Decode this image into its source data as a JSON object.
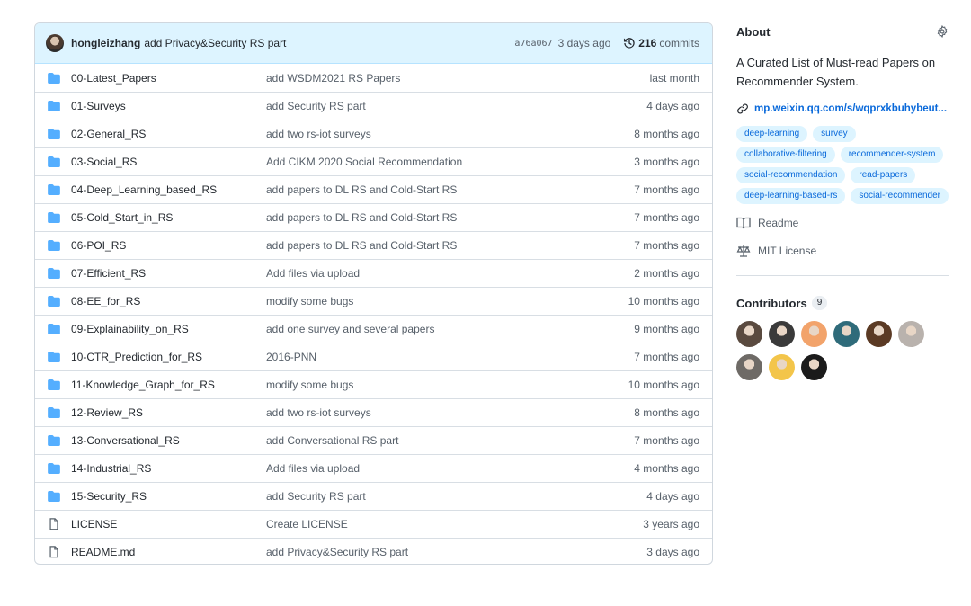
{
  "commit": {
    "author": "hongleizhang",
    "message": "add Privacy&Security RS part",
    "sha": "a76a067",
    "ago": "3 days ago",
    "count": "216",
    "count_label": "commits"
  },
  "files": [
    {
      "type": "dir",
      "name": "00-Latest_Papers",
      "message": "add WSDM2021 RS Papers",
      "age": "last month"
    },
    {
      "type": "dir",
      "name": "01-Surveys",
      "message": "add Security RS part",
      "age": "4 days ago"
    },
    {
      "type": "dir",
      "name": "02-General_RS",
      "message": "add two rs-iot surveys",
      "age": "8 months ago"
    },
    {
      "type": "dir",
      "name": "03-Social_RS",
      "message": "Add CIKM 2020 Social Recommendation",
      "age": "3 months ago"
    },
    {
      "type": "dir",
      "name": "04-Deep_Learning_based_RS",
      "message": "add papers to DL RS and Cold-Start RS",
      "age": "7 months ago"
    },
    {
      "type": "dir",
      "name": "05-Cold_Start_in_RS",
      "message": "add papers to DL RS and Cold-Start RS",
      "age": "7 months ago"
    },
    {
      "type": "dir",
      "name": "06-POI_RS",
      "message": "add papers to DL RS and Cold-Start RS",
      "age": "7 months ago"
    },
    {
      "type": "dir",
      "name": "07-Efficient_RS",
      "message": "Add files via upload",
      "age": "2 months ago"
    },
    {
      "type": "dir",
      "name": "08-EE_for_RS",
      "message": "modify some bugs",
      "age": "10 months ago"
    },
    {
      "type": "dir",
      "name": "09-Explainability_on_RS",
      "message": "add one survey and several papers",
      "age": "9 months ago"
    },
    {
      "type": "dir",
      "name": "10-CTR_Prediction_for_RS",
      "message": "2016-PNN",
      "age": "7 months ago"
    },
    {
      "type": "dir",
      "name": "11-Knowledge_Graph_for_RS",
      "message": "modify some bugs",
      "age": "10 months ago"
    },
    {
      "type": "dir",
      "name": "12-Review_RS",
      "message": "add two rs-iot surveys",
      "age": "8 months ago"
    },
    {
      "type": "dir",
      "name": "13-Conversational_RS",
      "message": "add Conversational RS part",
      "age": "7 months ago"
    },
    {
      "type": "dir",
      "name": "14-Industrial_RS",
      "message": "Add files via upload",
      "age": "4 months ago"
    },
    {
      "type": "dir",
      "name": "15-Security_RS",
      "message": "add Security RS part",
      "age": "4 days ago"
    },
    {
      "type": "file",
      "name": "LICENSE",
      "message": "Create LICENSE",
      "age": "3 years ago"
    },
    {
      "type": "file",
      "name": "README.md",
      "message": "add Privacy&Security RS part",
      "age": "3 days ago"
    }
  ],
  "about": {
    "title": "About",
    "description": "A Curated List of Must-read Papers on Recommender System.",
    "link": "mp.weixin.qq.com/s/wqprxkbuhybeut...",
    "topics": [
      "deep-learning",
      "survey",
      "collaborative-filtering",
      "recommender-system",
      "social-recommendation",
      "read-papers",
      "deep-learning-based-rs",
      "social-recommender"
    ],
    "readme": "Readme",
    "license": "MIT License"
  },
  "contributors": {
    "title": "Contributors",
    "count": "9",
    "avatars": [
      {
        "name": "contributor-1",
        "color": "#5a4a3f"
      },
      {
        "name": "contributor-2",
        "color": "#3a3a3a"
      },
      {
        "name": "contributor-3",
        "color": "#f2a36b"
      },
      {
        "name": "contributor-4",
        "color": "#2f6b7a"
      },
      {
        "name": "contributor-5",
        "color": "#5b3a24"
      },
      {
        "name": "contributor-6",
        "color": "#b9b2ad"
      },
      {
        "name": "contributor-7",
        "color": "#6e6a66"
      },
      {
        "name": "contributor-8",
        "color": "#f3c54a"
      },
      {
        "name": "contributor-9",
        "color": "#1b1b1b"
      }
    ]
  },
  "colors": {
    "accent": "#0969da",
    "folder": "#54aeff",
    "commit_bar": "#ddf4ff"
  }
}
